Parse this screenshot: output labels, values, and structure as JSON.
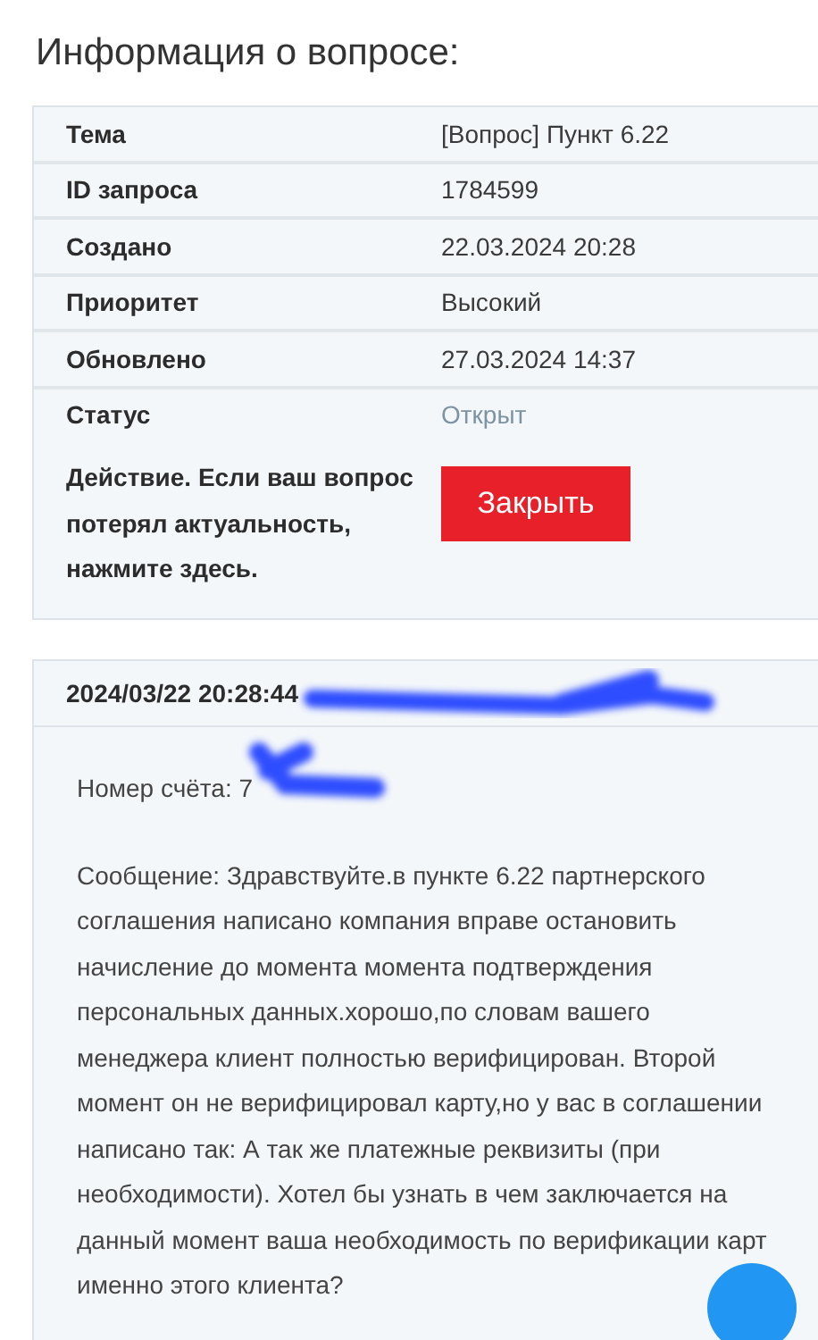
{
  "title": "Информация о вопросе:",
  "details": [
    {
      "label": "Тема",
      "value": "[Вопрос] Пункт 6.22",
      "kind": "text"
    },
    {
      "label": "ID запроса",
      "value": "1784599",
      "kind": "text"
    },
    {
      "label": "Создано",
      "value": "22.03.2024 20:28",
      "kind": "text"
    },
    {
      "label": "Приоритет",
      "value": "Высокий",
      "kind": "text"
    },
    {
      "label": "Обновлено",
      "value": "27.03.2024 14:37",
      "kind": "text"
    },
    {
      "label": "Статус",
      "value": "Открыт",
      "kind": "status"
    }
  ],
  "action": {
    "label": "Действие. Если ваш вопрос потерял актуальность, нажмите здесь.",
    "button": "Закрыть"
  },
  "message": {
    "header": "2024/03/22 20:28:44",
    "account": "Номер счёта: 7",
    "body": "Сообщение: Здравствуйте.в пункте 6.22 партнерского соглашения написано компания вправе остановить начисление до момента момента подтверждения персональных данных.хорошо,по словам вашего менеджера клиент полностью верифицирован. Второй момент он не верифицировал карту,но у вас в соглашении написано так: А так же платежные реквизиты (при необходимости). Хотел бы узнать в чем заключается на данный момент ваша необходимость по верификации карт именно этого клиента?"
  }
}
